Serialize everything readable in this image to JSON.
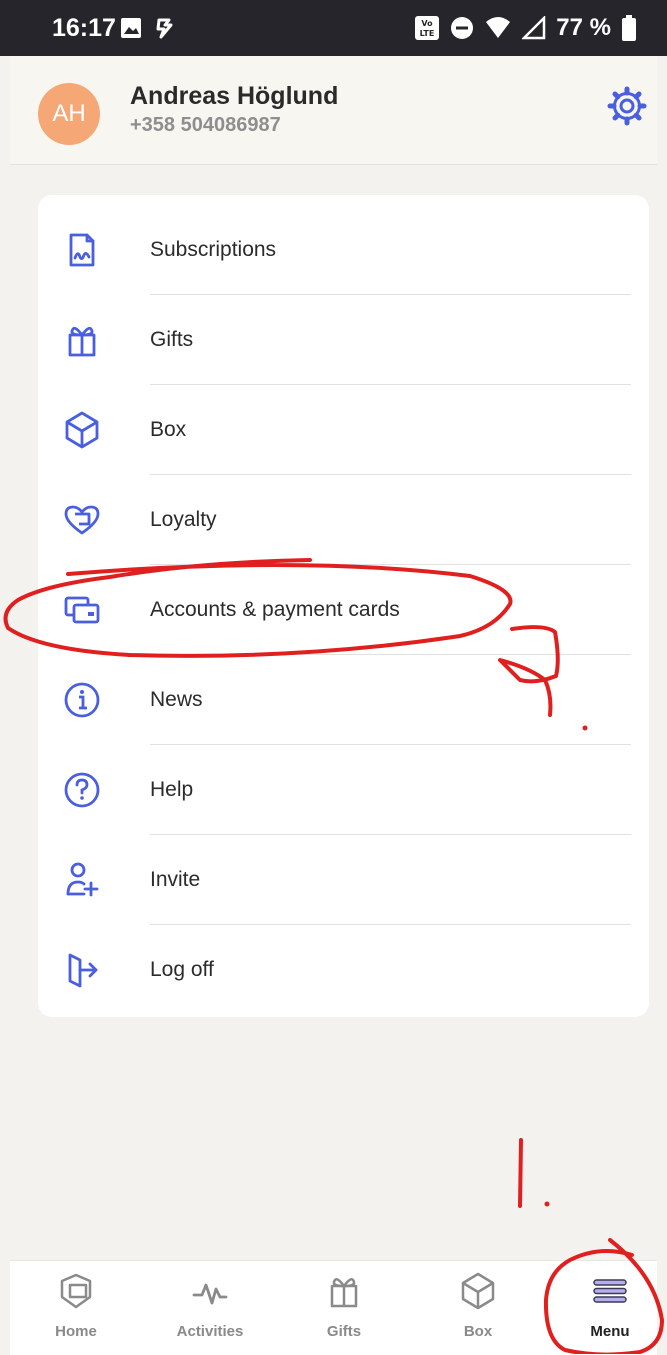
{
  "status_bar": {
    "time": "16:17",
    "battery": "77 %"
  },
  "profile": {
    "initials": "AH",
    "name": "Andreas Höglund",
    "phone": "+358 504086987"
  },
  "menu": {
    "items": [
      {
        "label": "Subscriptions",
        "icon": "subscriptions-icon"
      },
      {
        "label": "Gifts",
        "icon": "gift-icon"
      },
      {
        "label": "Box",
        "icon": "box-icon"
      },
      {
        "label": "Loyalty",
        "icon": "loyalty-heart-icon"
      },
      {
        "label": "Accounts & payment cards",
        "icon": "cards-icon"
      },
      {
        "label": "News",
        "icon": "info-icon"
      },
      {
        "label": "Help",
        "icon": "help-icon"
      },
      {
        "label": "Invite",
        "icon": "invite-user-icon"
      },
      {
        "label": "Log off",
        "icon": "log-off-icon"
      }
    ]
  },
  "bottom_nav": {
    "items": [
      {
        "label": "Home",
        "icon": "home-icon"
      },
      {
        "label": "Activities",
        "icon": "activity-icon"
      },
      {
        "label": "Gifts",
        "icon": "gift-icon"
      },
      {
        "label": "Box",
        "icon": "box-icon"
      },
      {
        "label": "Menu",
        "icon": "menu-icon",
        "active": true
      }
    ]
  },
  "annotations": {
    "step_marker": "1."
  },
  "colors": {
    "accent": "#4a5ee0",
    "avatar": "#f5a876",
    "active_nav": "#9d93e6",
    "annotation": "#e0201f"
  }
}
